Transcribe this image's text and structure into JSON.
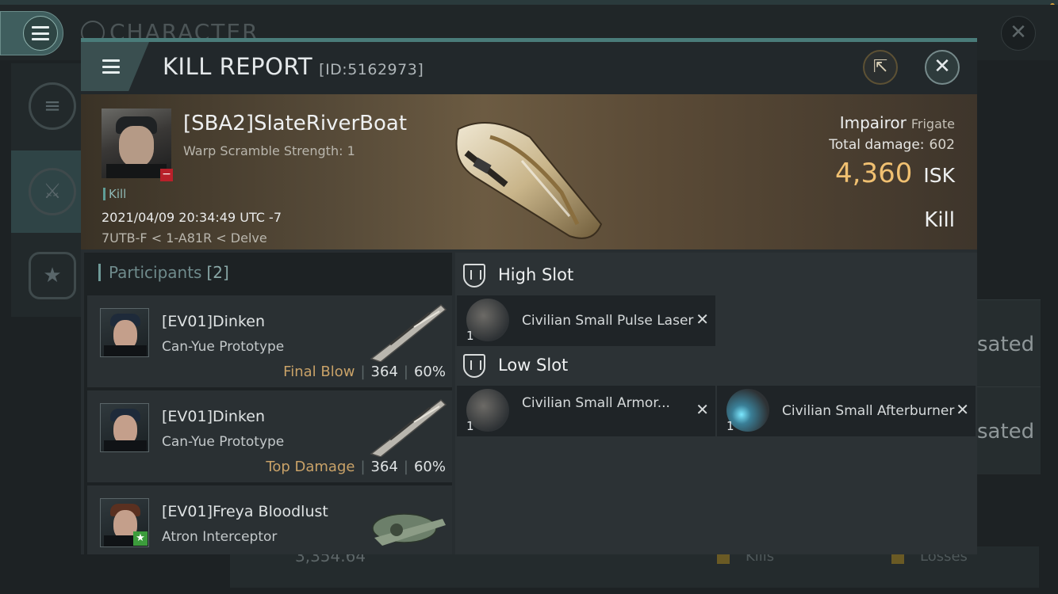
{
  "background": {
    "title": "CHARACTER",
    "right_text_1": "sated",
    "right_text_2": "sated",
    "bottom_value": "3,354.64",
    "bottom_kills": "Kills",
    "bottom_losses": "Losses"
  },
  "dialog": {
    "title": "KILL REPORT",
    "report_id": "[ID:5162973]"
  },
  "victim": {
    "name": "[SBA2]SlateRiverBoat",
    "warp_scramble": "Warp Scramble Strength: 1",
    "tag": "Kill",
    "datetime": "2021/04/09 20:34:49 UTC -7",
    "location": "7UTB-F < 1-A81R < Delve",
    "ship": "Impairor",
    "ship_class": "Frigate",
    "total_damage_label": "Total damage:",
    "total_damage": "602",
    "isk_value": "4,360",
    "isk_unit": "ISK",
    "result": "Kill"
  },
  "participants": {
    "label": "Participants",
    "count": "[2]",
    "rows": [
      {
        "name": "[EV01]Dinken",
        "ship": "Can-Yue Prototype",
        "tag": "Final Blow",
        "damage": "364",
        "percent": "60%"
      },
      {
        "name": "[EV01]Dinken",
        "ship": "Can-Yue Prototype",
        "tag": "Top Damage",
        "damage": "364",
        "percent": "60%"
      },
      {
        "name": "[EV01]Freya Bloodlust",
        "ship": "Atron Interceptor",
        "tag": "",
        "damage": "",
        "percent": ""
      }
    ]
  },
  "fitting": {
    "high_slot_label": "High Slot",
    "low_slot_label": "Low Slot",
    "high_modules": [
      {
        "qty": "1",
        "name": "Civilian Small Pulse Laser",
        "icon": "pulse-laser-icon"
      }
    ],
    "low_modules": [
      {
        "qty": "1",
        "name": "Civilian Small Armor...",
        "icon": "armor-repairer-icon"
      },
      {
        "qty": "1",
        "name": "Civilian Small Afterburner",
        "icon": "afterburner-icon"
      }
    ]
  },
  "colors": {
    "accent": "#4a7c7a",
    "isk": "#f0c071",
    "tag": "#c9a268",
    "dialog_bg": "#272d30"
  }
}
